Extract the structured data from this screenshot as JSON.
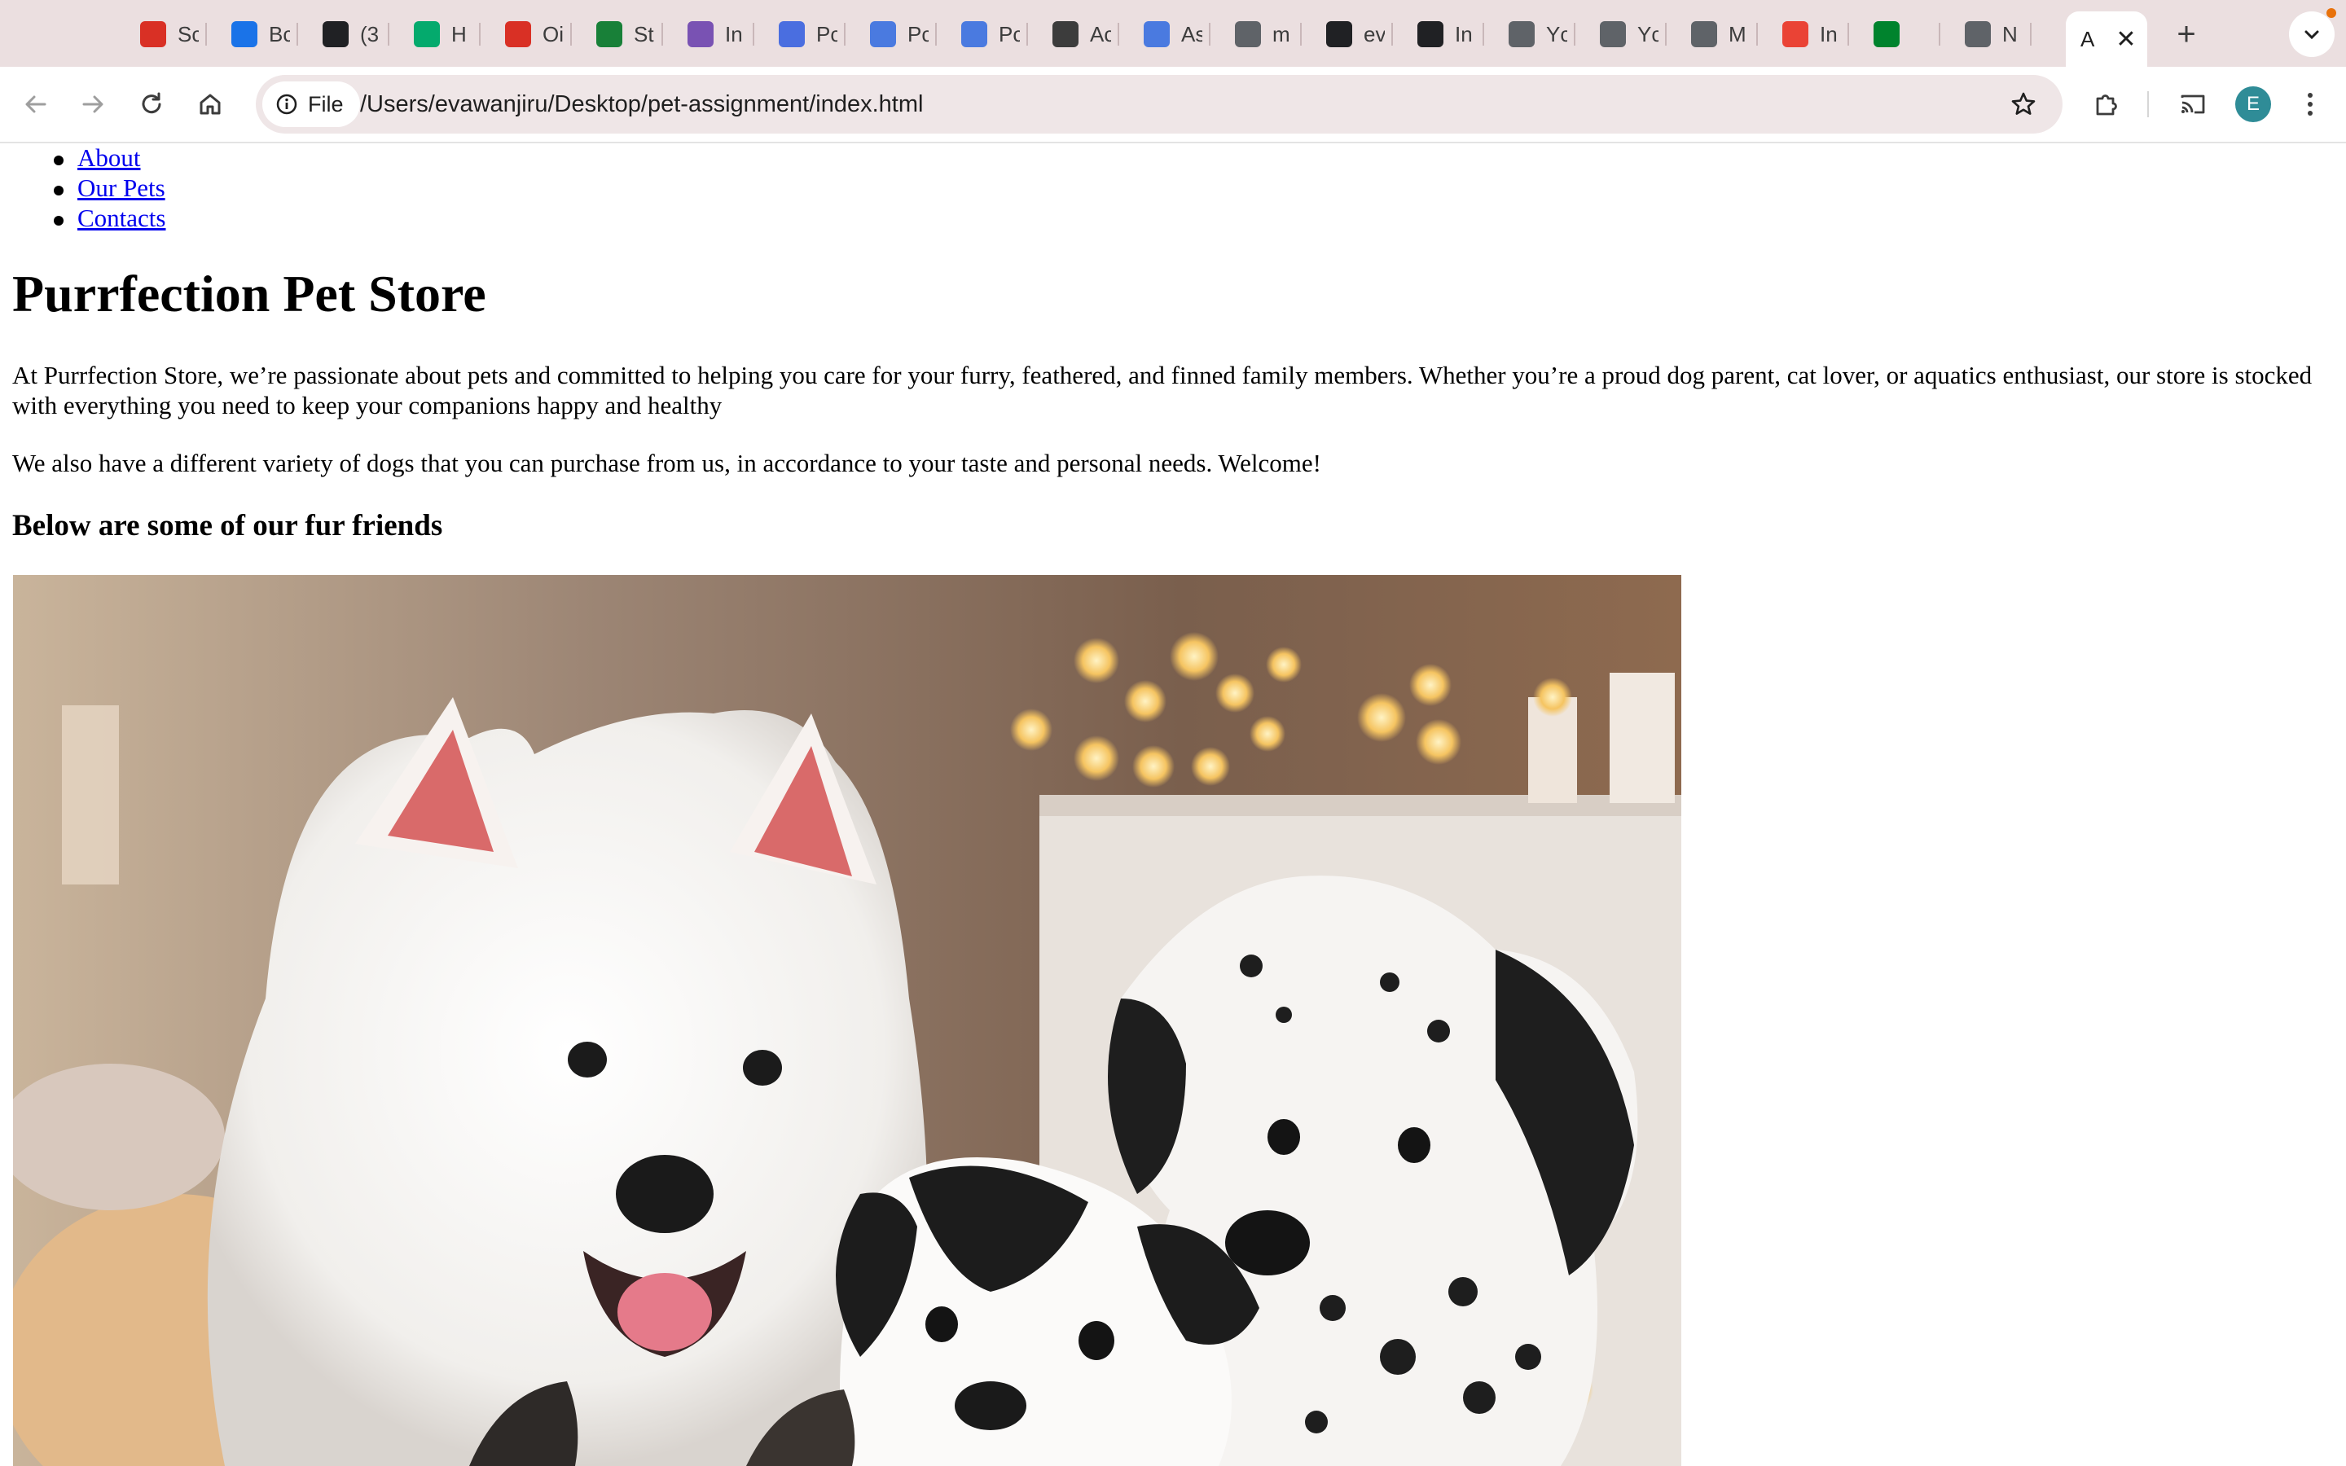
{
  "browser": {
    "tabs": [
      {
        "name": "tab-1",
        "icon": "code-icon",
        "label": "Sc",
        "color": "#d93025"
      },
      {
        "name": "tab-2",
        "icon": "star-bookmark-icon",
        "label": "Bc",
        "color": "#1a73e8"
      },
      {
        "name": "tab-3",
        "icon": "globe-dark-icon",
        "label": "(3",
        "color": "#202124"
      },
      {
        "name": "tab-4",
        "icon": "w3schools-icon",
        "label": "H",
        "color": "#04aa6d"
      },
      {
        "name": "tab-5",
        "icon": "ring-icon",
        "label": "Oi",
        "color": "#d93025"
      },
      {
        "name": "tab-6",
        "icon": "sheets-plus-icon",
        "label": "St",
        "color": "#188038"
      },
      {
        "name": "tab-7",
        "icon": "bootstrap-icon",
        "label": "In",
        "color": "#7952b3"
      },
      {
        "name": "tab-8",
        "icon": "contacts-icon",
        "label": "Pc",
        "color": "#4a6ee0"
      },
      {
        "name": "tab-9",
        "icon": "docs-icon",
        "label": "Pc",
        "color": "#4a7ae0"
      },
      {
        "name": "tab-10",
        "icon": "docs-icon",
        "label": "Pc",
        "color": "#4a7ae0"
      },
      {
        "name": "tab-11",
        "icon": "figure-icon",
        "label": "Ac",
        "color": "#3c3c3c"
      },
      {
        "name": "tab-12",
        "icon": "docs-icon",
        "label": "As",
        "color": "#4a7ae0"
      },
      {
        "name": "tab-13",
        "icon": "globe-icon",
        "label": "m",
        "color": "#5f6368"
      },
      {
        "name": "tab-14",
        "icon": "github-icon",
        "label": "ev",
        "color": "#202124"
      },
      {
        "name": "tab-15",
        "icon": "openai-icon",
        "label": "In",
        "color": "#202124"
      },
      {
        "name": "tab-16",
        "icon": "globe-icon",
        "label": "Yc",
        "color": "#5f6368"
      },
      {
        "name": "tab-17",
        "icon": "globe-icon",
        "label": "Yc",
        "color": "#5f6368"
      },
      {
        "name": "tab-18",
        "icon": "globe-icon",
        "label": "M",
        "color": "#5f6368"
      },
      {
        "name": "tab-19",
        "icon": "gmail-icon",
        "label": "In",
        "color": "#ea4335"
      },
      {
        "name": "tab-20",
        "icon": "meet-recording-icon",
        "label": "",
        "color": "#00832d"
      },
      {
        "name": "tab-21",
        "icon": "chrome-icon",
        "label": "N",
        "color": "#5f6368"
      }
    ],
    "active_tab_label": "A",
    "active_tab_close": "✕",
    "new_tab": "+",
    "site_chip": "File",
    "url": "/Users/evawanjiru/Desktop/pet-assignment/index.html",
    "profile_initial": "E",
    "accent": "#2f8c97"
  },
  "page": {
    "nav": [
      "About",
      "Our Pets",
      "Contacts"
    ],
    "title": "Purrfection Pet Store",
    "intro": "At Purrfection Store, we’re passionate about pets and committed to helping you care for your furry, feathered, and finned family members. Whether you’re a proud dog parent, cat lover, or aquatics enthusiast, our store is stocked with everything you need to keep your companions happy and healthy",
    "variety": "We also have a different variety of dogs that you can purchase from us, in accordance to your taste and personal needs. Welcome!",
    "subheading": "Below are some of our fur friends",
    "link_color": "#0000ee"
  }
}
